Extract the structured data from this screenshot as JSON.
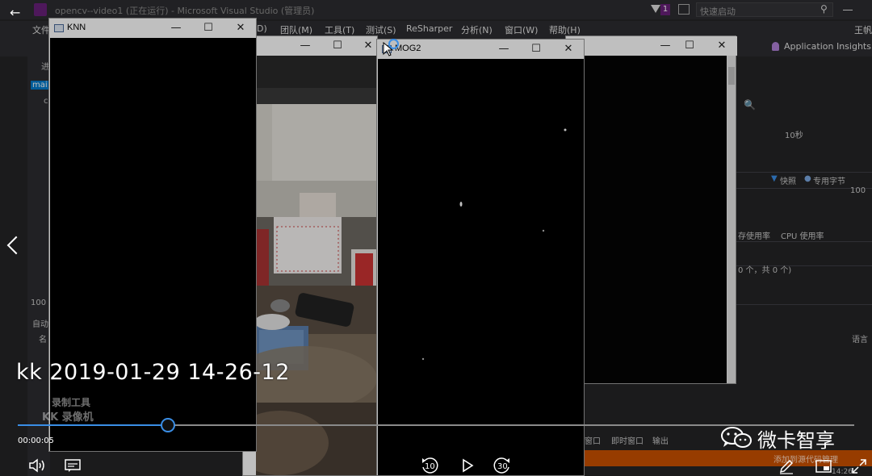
{
  "vs": {
    "title": "opencv--video1 (正在运行) - Microsoft Visual Studio (管理员)",
    "notification_count": "1",
    "quick_launch_placeholder": "快速启动",
    "menu": [
      {
        "label": "文件"
      },
      {
        "label": "D)"
      },
      {
        "label": "团队(M)"
      },
      {
        "label": "工具(T)"
      },
      {
        "label": "测试(S)"
      },
      {
        "label": "ReSharper"
      },
      {
        "label": "分析(N)"
      },
      {
        "label": "窗口(W)"
      },
      {
        "label": "帮助(H)"
      }
    ],
    "user": "王帆",
    "app_insights": "Application Insights",
    "left_fragments": {
      "jin": "进",
      "main": "mai",
      "c": "c",
      "pct": "100 %",
      "auto": "自动",
      "ming": "名"
    },
    "diag": {
      "time_label": "10秒",
      "snapshot": "快照",
      "private_bytes": "专用字节",
      "value_100": "100",
      "mem_usage": "存使用率",
      "cpu_usage": "CPU 使用率",
      "count_text": "0 个，共 0 个)",
      "lang": "语言"
    },
    "bottom_tabs": {
      "win": "窗口",
      "immediate": "即时窗口",
      "output": "输出"
    },
    "source_control": "添加到源代码管理",
    "clock": "14:26"
  },
  "windows": {
    "knn": {
      "title": "KNN",
      "min": "—",
      "max": "☐",
      "close": "✕"
    },
    "frame": {
      "title": "",
      "min": "—",
      "max": "☐",
      "close": "✕"
    },
    "mog2": {
      "title": "MOG2",
      "min": "—",
      "max": "☐",
      "close": "✕"
    },
    "output": {
      "min": "—",
      "max": "☐",
      "close": "✕"
    }
  },
  "player": {
    "watermark": "kk 2019-01-29 14-26-12",
    "recorder_line1": "录制工具",
    "recorder_line2": "KK 录像机",
    "current_time": "00:00:05",
    "progress": 0.18,
    "rewind_seconds": "10",
    "forward_seconds": "30",
    "brand": "微卡智享",
    "accent": "#3a8ee6"
  }
}
